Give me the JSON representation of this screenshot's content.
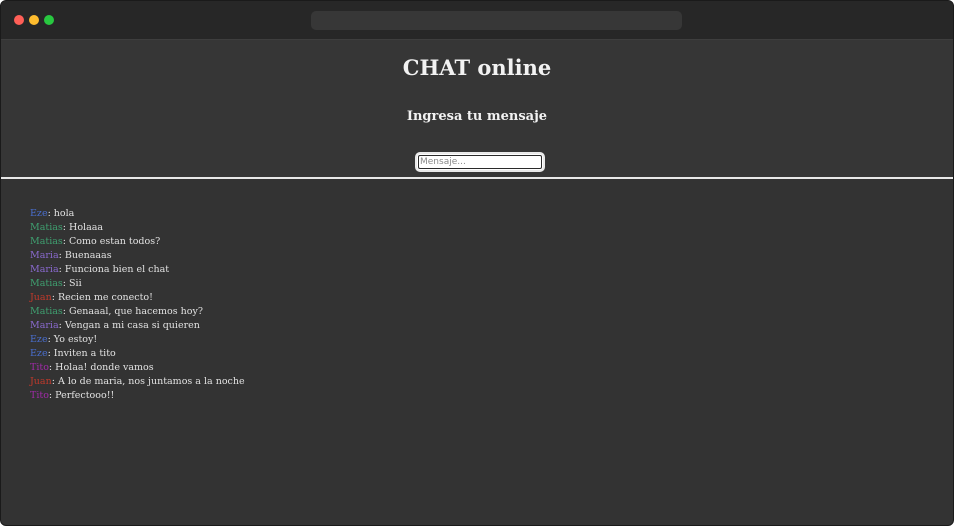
{
  "header": {
    "title": "CHAT online",
    "subtitle": "Ingresa tu mensaje",
    "input_placeholder": "Mensaje...",
    "input_value": ""
  },
  "user_colors": {
    "Eze": "#4a6fd0",
    "Matias": "#3fa070",
    "Maria": "#8a6ad0",
    "Juan": "#c0392b",
    "Tito": "#a02aa8"
  },
  "messages": [
    {
      "user": "Eze",
      "text": "hola"
    },
    {
      "user": "Matias",
      "text": "Holaaa"
    },
    {
      "user": "Matias",
      "text": "Como estan todos?"
    },
    {
      "user": "Maria",
      "text": "Buenaaas"
    },
    {
      "user": "Maria",
      "text": "Funciona bien el chat"
    },
    {
      "user": "Matias",
      "text": "Sii"
    },
    {
      "user": "Juan",
      "text": "Recien me conecto!"
    },
    {
      "user": "Matias",
      "text": "Genaaal, que hacemos hoy?"
    },
    {
      "user": "Maria",
      "text": "Vengan a mi casa si quieren"
    },
    {
      "user": "Eze",
      "text": "Yo estoy!"
    },
    {
      "user": "Eze",
      "text": "Inviten a tito"
    },
    {
      "user": "Tito",
      "text": "Holaa! donde vamos"
    },
    {
      "user": "Juan",
      "text": "A lo de maria, nos juntamos a la noche"
    },
    {
      "user": "Tito",
      "text": "Perfectooo!!"
    }
  ]
}
